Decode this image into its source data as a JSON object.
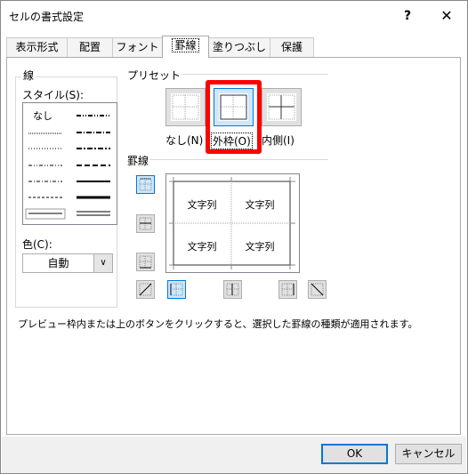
{
  "window": {
    "title": "セルの書式設定",
    "help_label": "?",
    "close_label": "✕"
  },
  "tabs": [
    {
      "label": "表示形式",
      "active": false
    },
    {
      "label": "配置",
      "active": false
    },
    {
      "label": "フォント",
      "active": false
    },
    {
      "label": "罫線",
      "active": true
    },
    {
      "label": "塗りつぶし",
      "active": false
    },
    {
      "label": "保護",
      "active": false
    }
  ],
  "line_group": {
    "title": "線",
    "style_label": "スタイル(S):",
    "none_label": "なし",
    "color_label": "色(C):",
    "color_value": "自動"
  },
  "presets": {
    "title": "プリセット",
    "items": [
      {
        "label": "なし(N)",
        "selected": false
      },
      {
        "label": "外枠(O)",
        "selected": true
      },
      {
        "label": "内側(I)",
        "selected": false
      }
    ]
  },
  "border": {
    "title": "罫線",
    "cell_text": "文字列"
  },
  "info": "プレビュー枠内または上のボタンをクリックすると、選択した罫線の種類が適用されます。",
  "buttons": {
    "ok": "OK",
    "cancel": "キャンセル"
  },
  "colors": {
    "accent": "#0078d7",
    "highlight": "#ff0000",
    "selected_bg": "#cce8ff"
  }
}
